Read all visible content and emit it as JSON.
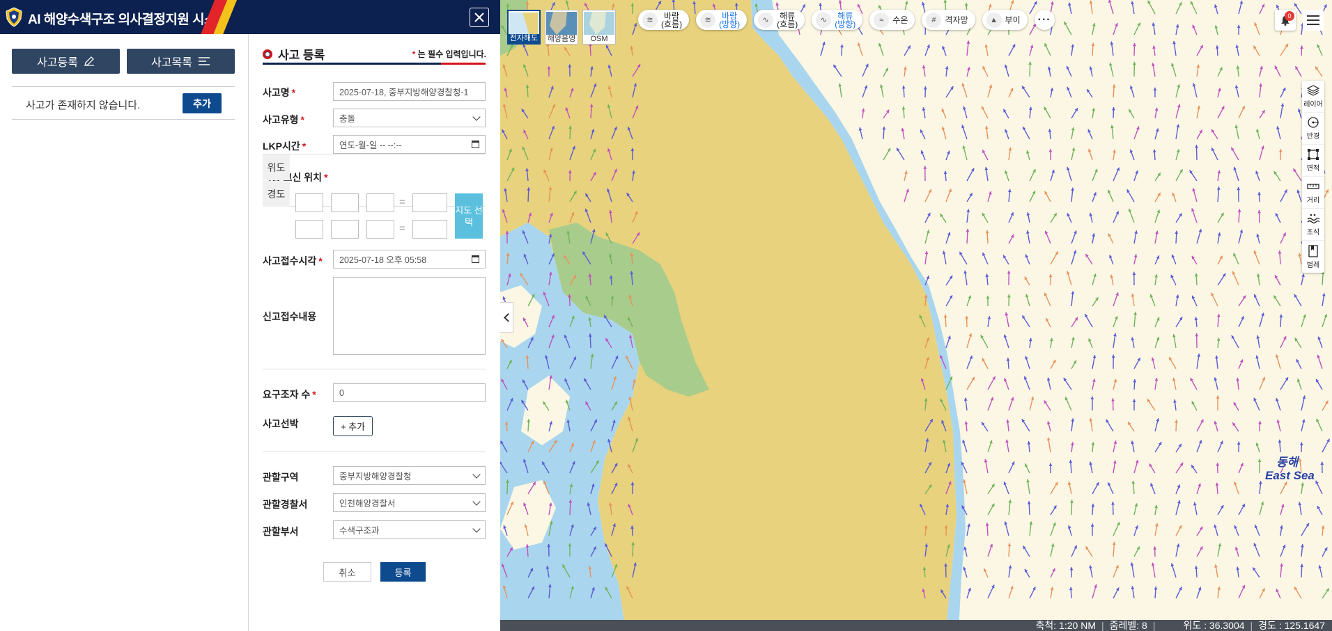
{
  "header": {
    "title": "AI 해양수색구조 의사결정지원 시스템"
  },
  "left_panel": {
    "register_button": "사고등록",
    "list_button": "사고목록",
    "empty_message": "사고가 존재하지 않습니다.",
    "add_button": "추가"
  },
  "form": {
    "title": "사고 등록",
    "required_note_star": "*",
    "required_note": "는 필수 입력입니다.",
    "fields": {
      "accident_name": {
        "label": "사고명",
        "value": "2025-07-18, 중부지방해양경찰청-1"
      },
      "accident_type": {
        "label": "사고유형",
        "value": "충돌"
      },
      "lkp_time": {
        "label": "LKP시간",
        "value": "연도-월-일 -- --:--"
      },
      "final_position": {
        "label": "최종 교신 위치"
      },
      "latitude_label": "위도",
      "longitude_label": "경도",
      "map_select": "지도 선택",
      "received_time": {
        "label": "사고접수시각",
        "value": "2025-07-18 오후 05:58"
      },
      "report_content": {
        "label": "신고접수내용"
      },
      "rescue_count": {
        "label": "요구조자 수",
        "value": "0"
      },
      "vessel": {
        "label": "사고선박",
        "button": "+ 추가"
      },
      "jurisdiction": {
        "label": "관할구역",
        "value": "중부지방해양경찰청"
      },
      "police_station": {
        "label": "관할경찰서",
        "value": "인천해양경찰서"
      },
      "department": {
        "label": "관할부서",
        "value": "수색구조과"
      }
    },
    "cancel_button": "취소",
    "submit_button": "등록"
  },
  "map": {
    "basemaps": [
      {
        "label": "전자해도",
        "active": true
      },
      {
        "label": "해양음영",
        "active": false
      },
      {
        "label": "OSM",
        "active": false
      }
    ],
    "layers": [
      {
        "label": "바람\n(흐름)",
        "selected": false
      },
      {
        "label": "바람\n(방향)",
        "selected": true
      },
      {
        "label": "해류\n(흐름)",
        "selected": false
      },
      {
        "label": "해류\n(방향)",
        "selected": true
      },
      {
        "label": "수온",
        "selected": false
      },
      {
        "label": "격자망",
        "selected": false
      },
      {
        "label": "부이",
        "selected": false
      }
    ],
    "more": "···",
    "notification_count": "0",
    "tools": [
      "레이어",
      "반경",
      "면적",
      "거리",
      "조석",
      "범례"
    ],
    "labels": {
      "donghae_ko": "동해",
      "donghae_en": "East Sea"
    },
    "status": {
      "scale": "축척: 1:20 NM",
      "zoom": "줌레벨: 8",
      "lat": "위도 : 36.3004",
      "lon": "경도 : 125.1647"
    },
    "colors": {
      "land": "#e8d27d",
      "shallow_sea": "#a9d6ee",
      "deep_sea": "#fbf7e4",
      "green_land": "#a8cc8c"
    }
  }
}
